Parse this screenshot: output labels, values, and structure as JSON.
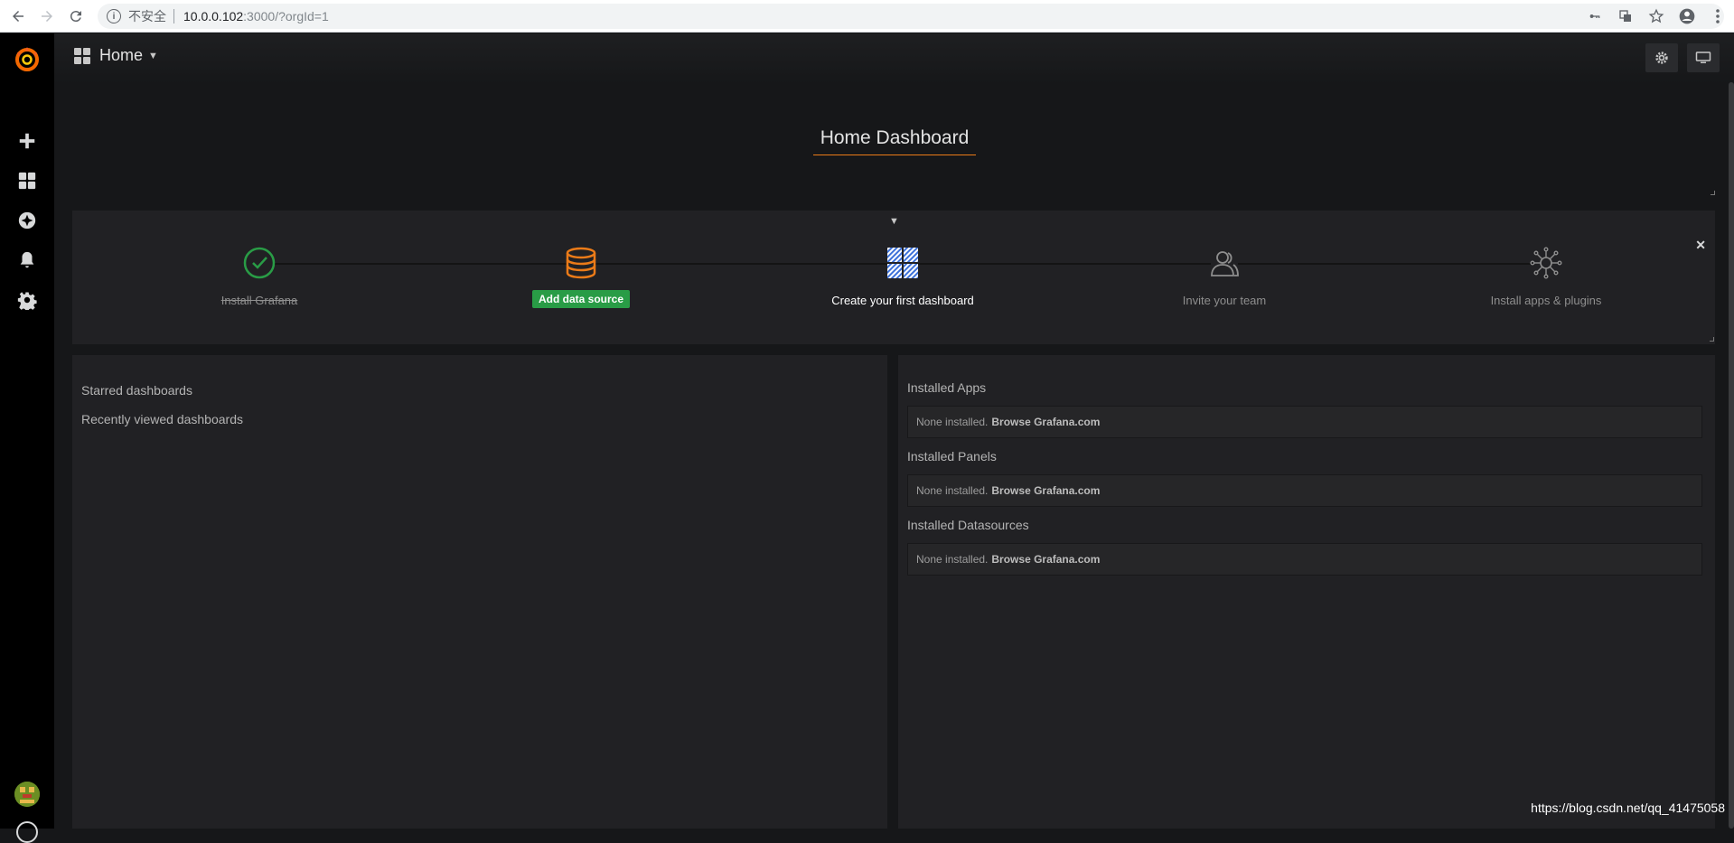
{
  "browser": {
    "secure_label": "不安全",
    "url_host": "10.0.0.102",
    "url_path": ":3000/?orgId=1"
  },
  "sidebar": {
    "items": [
      "create",
      "dashboards",
      "explore",
      "alerting",
      "configuration"
    ]
  },
  "navbar": {
    "title": "Home"
  },
  "dashboard": {
    "title": "Home Dashboard"
  },
  "getting_started": {
    "steps": [
      {
        "label": "Install Grafana",
        "state": "done"
      },
      {
        "label": "Add data source",
        "state": "button"
      },
      {
        "label": "Create your first dashboard",
        "state": "active"
      },
      {
        "label": "Invite your team",
        "state": "pending"
      },
      {
        "label": "Install apps & plugins",
        "state": "pending"
      }
    ]
  },
  "dashboard_list": {
    "starred": "Starred dashboards",
    "recent": "Recently viewed dashboards"
  },
  "plugins": {
    "sections": [
      {
        "title": "Installed Apps",
        "none_text": "None installed.",
        "link_text": "Browse Grafana.com"
      },
      {
        "title": "Installed Panels",
        "none_text": "None installed.",
        "link_text": "Browse Grafana.com"
      },
      {
        "title": "Installed Datasources",
        "none_text": "None installed.",
        "link_text": "Browse Grafana.com"
      }
    ]
  },
  "watermark": "https://blog.csdn.net/qq_41475058",
  "colors": {
    "accent": "#eb7b18",
    "success": "#299c46",
    "check": "#299c46"
  }
}
